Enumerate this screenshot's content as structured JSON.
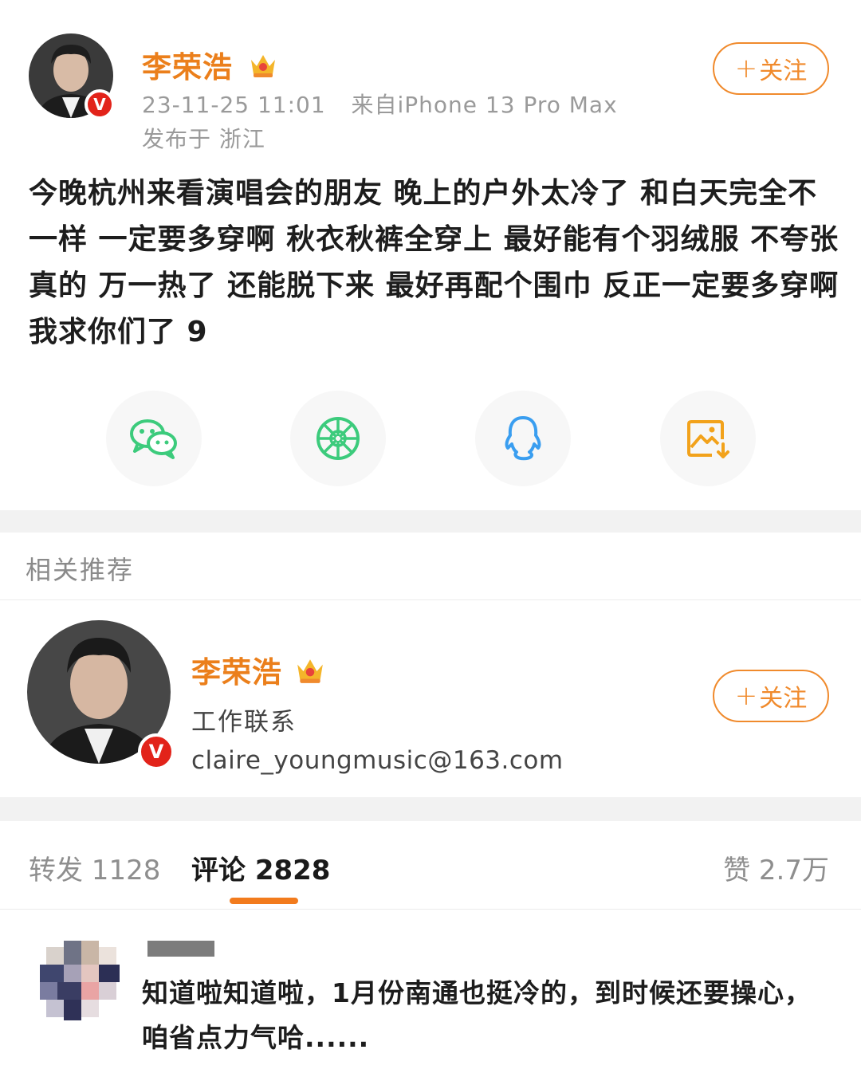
{
  "post": {
    "author": "李荣浩",
    "timestamp": "23-11-25 11:01",
    "source": "来自iPhone 13 Pro Max",
    "location": "发布于 浙江",
    "follow_label": "关注",
    "text": "今晚杭州来看演唱会的朋友  晚上的户外太冷了 和白天完全不一样 一定要多穿啊 秋衣秋裤全穿上 最好能有个羽绒服 不夸张 真的 万一热了 还能脱下来  最好再配个围巾 反正一定要多穿啊 我求你们了 9",
    "badge": "V",
    "share": [
      {
        "icon": "wechat-icon",
        "color": "#3ccb7c"
      },
      {
        "icon": "moments-icon",
        "color": "#3ccb7c"
      },
      {
        "icon": "qq-icon",
        "color": "#3a9ef0"
      },
      {
        "icon": "save-image-icon",
        "color": "#f2a21b"
      }
    ]
  },
  "recommend": {
    "section_title": "相关推荐",
    "name": "李荣浩",
    "subtitle": "工作联系",
    "email": "claire_youngmusic@163.com",
    "follow_label": "关注",
    "badge": "V"
  },
  "tabs": {
    "repost": "转发 1128",
    "comments": "评论 2828",
    "likes": "赞 2.7万"
  },
  "comment": {
    "text": "知道啦知道啦，1月份南通也挺冷的，到时候还要操心，咱省点力气哈......"
  },
  "colors": {
    "accent": "#eb7f1b",
    "badge": "#e2231a"
  }
}
